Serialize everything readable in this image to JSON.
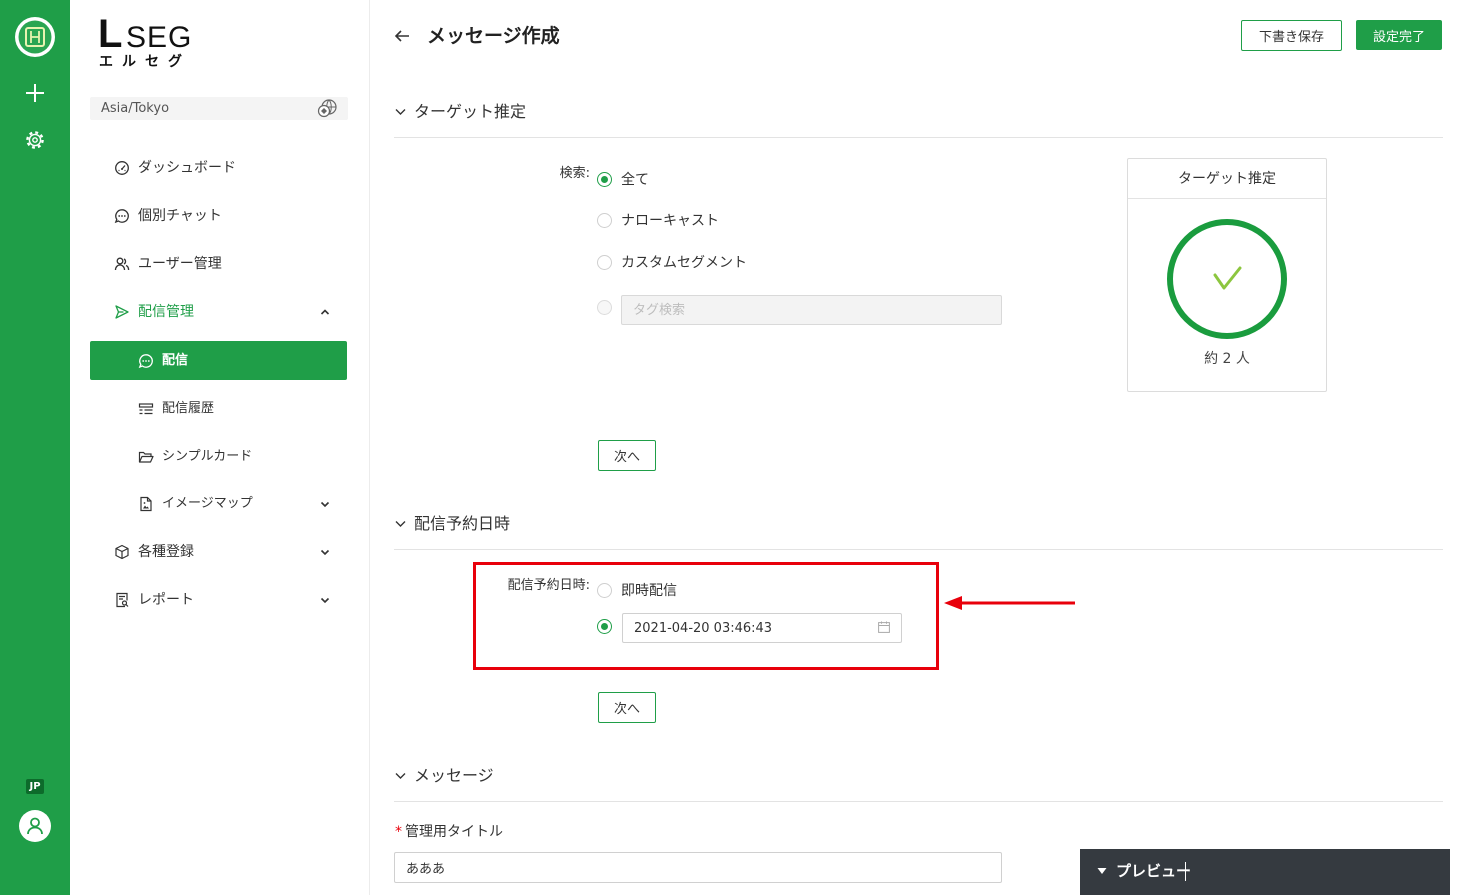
{
  "colors": {
    "brand_green": "#1f9e48",
    "alert_red": "#e8000b",
    "preview_bar": "#353a40",
    "check_green": "#8cc63f"
  },
  "rail": {
    "logo_icon": "app-logo-icon",
    "add_icon": "plus-icon",
    "settings_icon": "gear-icon",
    "language_badge": "JP",
    "user_icon": "user-avatar-icon"
  },
  "brand": {
    "logo_initial": "L",
    "logo_rest": "SEG",
    "logo_kana": "エルセグ"
  },
  "timezone": {
    "value": "Asia/Tokyo",
    "icon": "globe-icon"
  },
  "sidebar": {
    "items": [
      {
        "label": "ダッシュボード",
        "icon": "dashboard-icon"
      },
      {
        "label": "個別チャット",
        "icon": "chat-icon"
      },
      {
        "label": "ユーザー管理",
        "icon": "users-icon"
      },
      {
        "label": "配信管理",
        "icon": "send-icon",
        "expanded": true,
        "children": [
          {
            "label": "配信",
            "icon": "chat-icon",
            "active": true
          },
          {
            "label": "配信履歴",
            "icon": "list-icon"
          },
          {
            "label": "シンプルカード",
            "icon": "folder-icon"
          },
          {
            "label": "イメージマップ",
            "icon": "file-image-icon",
            "expandable": true
          }
        ]
      },
      {
        "label": "各種登録",
        "icon": "cube-icon",
        "expandable": true
      },
      {
        "label": "レポート",
        "icon": "report-icon",
        "expandable": true
      }
    ]
  },
  "header": {
    "title": "メッセージ作成",
    "back_icon": "arrow-left-icon",
    "save_draft_button": "下書き保存",
    "complete_button": "設定完了"
  },
  "target_section": {
    "title": "ターゲット推定",
    "search_label": "検索:",
    "options": [
      {
        "label": "全て",
        "selected": true
      },
      {
        "label": "ナローキャスト",
        "selected": false
      },
      {
        "label": "カスタムセグメント",
        "selected": false
      }
    ],
    "tag_option_selected": false,
    "tag_search_placeholder": "タグ検索",
    "card": {
      "title": "ターゲット推定",
      "estimate": "約 2 人",
      "icon": "check-circle-icon"
    },
    "next_button": "次へ"
  },
  "schedule_section": {
    "title": "配信予約日時",
    "label": "配信予約日時:",
    "immediate_label": "即時配信",
    "immediate_selected": false,
    "scheduled_selected": true,
    "datetime_value": "2021-04-20 03:46:43",
    "calendar_icon": "calendar-icon",
    "next_button": "次へ"
  },
  "message_section": {
    "title": "メッセージ",
    "required_mark": "*",
    "title_label": "管理用タイトル",
    "title_value": "あああ"
  },
  "preview": {
    "label": "プレビュー",
    "toggle_icon": "caret-down-icon"
  }
}
